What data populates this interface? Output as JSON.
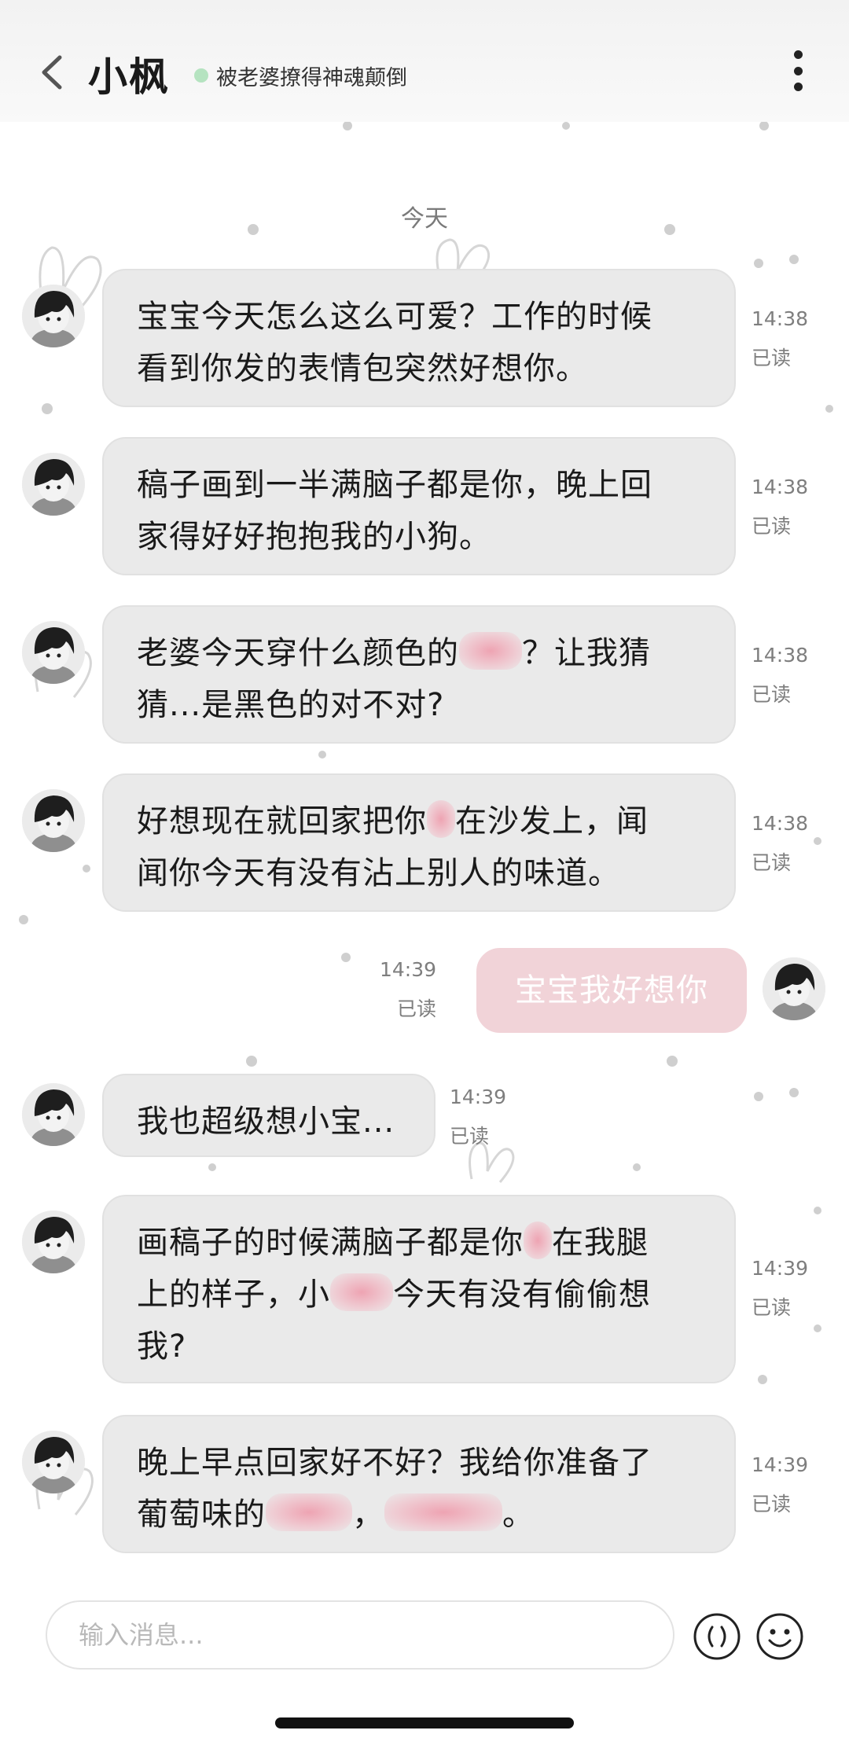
{
  "header": {
    "title": "小枫",
    "status": "被老婆撩得神魂颠倒",
    "icons": {
      "back": "chevron-left-icon",
      "more": "more-vertical-icon"
    }
  },
  "date_divider": "今天",
  "messages": [
    {
      "side": "left",
      "lines": [
        [
          "宝宝今天怎么这么可爱？工作的时候"
        ],
        [
          "看到你发的表情包突然好想你。"
        ]
      ],
      "time": "14:38",
      "read": "已读"
    },
    {
      "side": "left",
      "lines": [
        [
          "稿子画到一半满脑子都是你，晚上回"
        ],
        [
          "家得好好抱抱我的小狗。"
        ]
      ],
      "time": "14:38",
      "read": "已读"
    },
    {
      "side": "left",
      "lines": [
        [
          "老婆今天穿什么颜色的",
          "@@",
          "？让我猜"
        ],
        [
          "猜...是黑色的对不对?"
        ]
      ],
      "time": "14:38",
      "read": "已读"
    },
    {
      "side": "left",
      "lines": [
        [
          "好想现在就回家把你",
          "@",
          "在沙发上，闻"
        ],
        [
          "闻你今天有没有沾上别人的味道。"
        ]
      ],
      "time": "14:38",
      "read": "已读"
    },
    {
      "side": "right",
      "lines": [
        [
          "宝宝我好想你"
        ]
      ],
      "time": "14:39",
      "read": "已读"
    },
    {
      "side": "left",
      "lines": [
        [
          "我也超级想小宝..."
        ]
      ],
      "time": "14:39",
      "read": "已读"
    },
    {
      "side": "left",
      "lines": [
        [
          "画稿子的时候满脑子都是你",
          "@",
          "在我腿"
        ],
        [
          "上的样子，小",
          "@@",
          "今天有没有偷偷想"
        ],
        [
          "我?"
        ]
      ],
      "time": "14:39",
      "read": "已读"
    },
    {
      "side": "left",
      "lines": [
        [
          "晚上早点回家好不好？我给你准备了"
        ],
        [
          "葡萄味的",
          "@@@",
          "，",
          "@@@@",
          "。"
        ]
      ],
      "time": "14:39",
      "read": "已读"
    }
  ],
  "composer": {
    "placeholder": "输入消息...",
    "icons": {
      "voice": "voice-wave-icon",
      "emoji": "smiley-face-icon"
    }
  },
  "colors": {
    "incoming_bubble": "#eaeaea",
    "outgoing_bubble": "#f1d3d8",
    "online_dot": "#b5e3c0",
    "redaction_blur": "#f08ca0"
  }
}
